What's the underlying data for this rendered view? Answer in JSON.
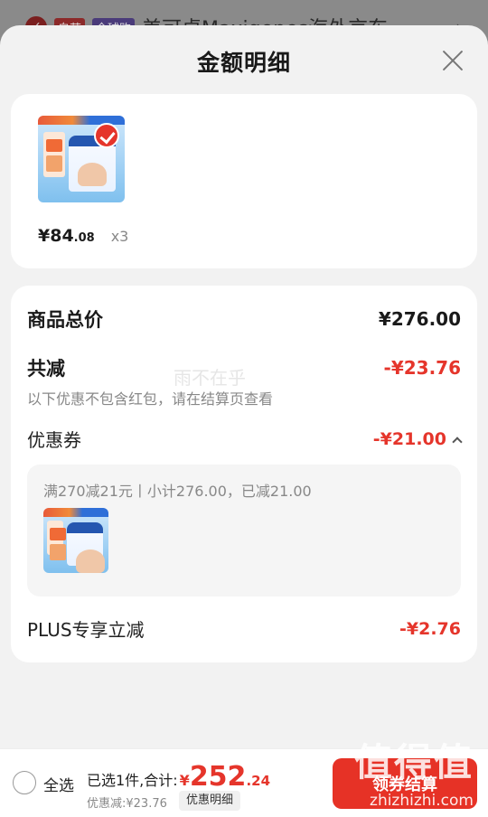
{
  "background_header": {
    "tags": [
      "自营",
      "全球购"
    ],
    "store_name": "美可卓Maxigenes海外京东"
  },
  "sheet": {
    "title": "金额明细"
  },
  "product": {
    "price_int": "¥84",
    "price_dec": ".08",
    "quantity": "x3"
  },
  "details": {
    "total_label": "商品总价",
    "total_value": "¥276.00",
    "reduced_label": "共减",
    "reduced_value": "-¥23.76",
    "reduced_note": "以下优惠不包含红包，请在结算页查看",
    "watermark": "雨不在乎",
    "coupon_label": "优惠券",
    "coupon_value": "-¥21.00",
    "coupon_detail": "满270减21元丨小计276.00，已减21.00",
    "plus_label": "PLUS专享立减",
    "plus_value": "-¥2.76"
  },
  "bottom_bar": {
    "select_all": "全选",
    "selected_summary": "已选1件,合计:",
    "total_symbol": "¥",
    "total_int": "252",
    "total_dec": ".24",
    "reduced_text": "优惠减:¥23.76",
    "detail_button": "优惠明细",
    "checkout_button": "领券结算"
  },
  "brand_watermark": {
    "glyphs": "值得值",
    "domain": "zhizhizhi.com"
  },
  "colors": {
    "accent": "#e5352b",
    "checkout": "#e63226"
  }
}
